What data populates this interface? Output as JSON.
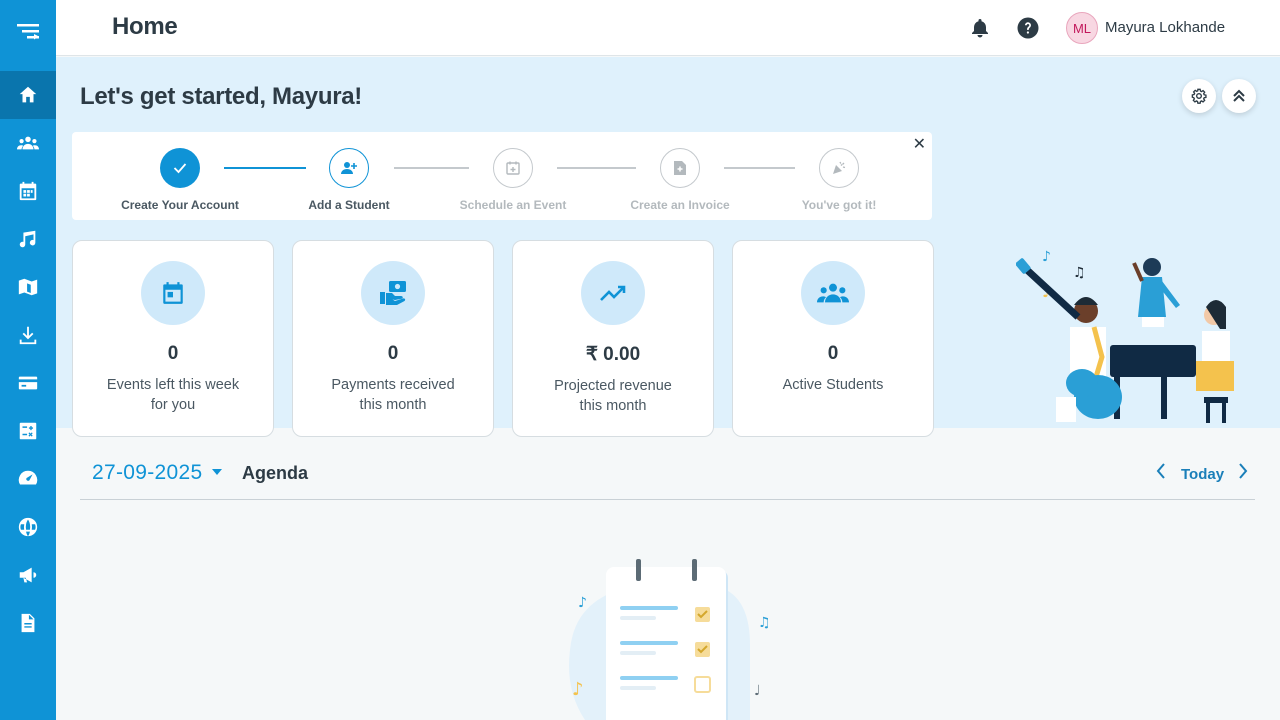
{
  "header": {
    "title": "Home",
    "user": {
      "initials": "ML",
      "name": "Mayura Lokhande"
    }
  },
  "hero": {
    "greeting": "Let's get started, Mayura!"
  },
  "stepper": {
    "steps": [
      {
        "label": "Create Your Account",
        "state": "done"
      },
      {
        "label": "Add a Student",
        "state": "current"
      },
      {
        "label": "Schedule an Event",
        "state": "pending"
      },
      {
        "label": "Create an Invoice",
        "state": "pending"
      },
      {
        "label": "You've got it!",
        "state": "pending"
      }
    ],
    "close_symbol": "✕"
  },
  "stats": [
    {
      "icon": "calendar-icon",
      "value": "0",
      "label": "Events left this week for you"
    },
    {
      "icon": "payment-hand-icon",
      "value": "0",
      "label": "Payments received this month"
    },
    {
      "icon": "trend-up-icon",
      "value": "₹ 0.00",
      "label": "Projected revenue this month"
    },
    {
      "icon": "group-icon",
      "value": "0",
      "label": "Active Students"
    }
  ],
  "agenda": {
    "date": "27-09-2025",
    "title": "Agenda",
    "today_label": "Today"
  },
  "colors": {
    "brand": "#0f93d6",
    "sidebar_active": "#0a75ad",
    "hero_bg": "#dff1fc",
    "step_done": "#0f93d6",
    "step_pending": "#c4c9cd"
  },
  "sidebar": {
    "items": [
      {
        "icon": "logo-icon"
      },
      {
        "icon": "home-icon",
        "active": true
      },
      {
        "icon": "students-icon"
      },
      {
        "icon": "calendar-icon"
      },
      {
        "icon": "music-note-icon"
      },
      {
        "icon": "book-icon"
      },
      {
        "icon": "download-icon"
      },
      {
        "icon": "credit-card-icon"
      },
      {
        "icon": "calculator-icon"
      },
      {
        "icon": "dashboard-gauge-icon"
      },
      {
        "icon": "globe-icon"
      },
      {
        "icon": "megaphone-icon"
      },
      {
        "icon": "document-icon"
      }
    ]
  }
}
